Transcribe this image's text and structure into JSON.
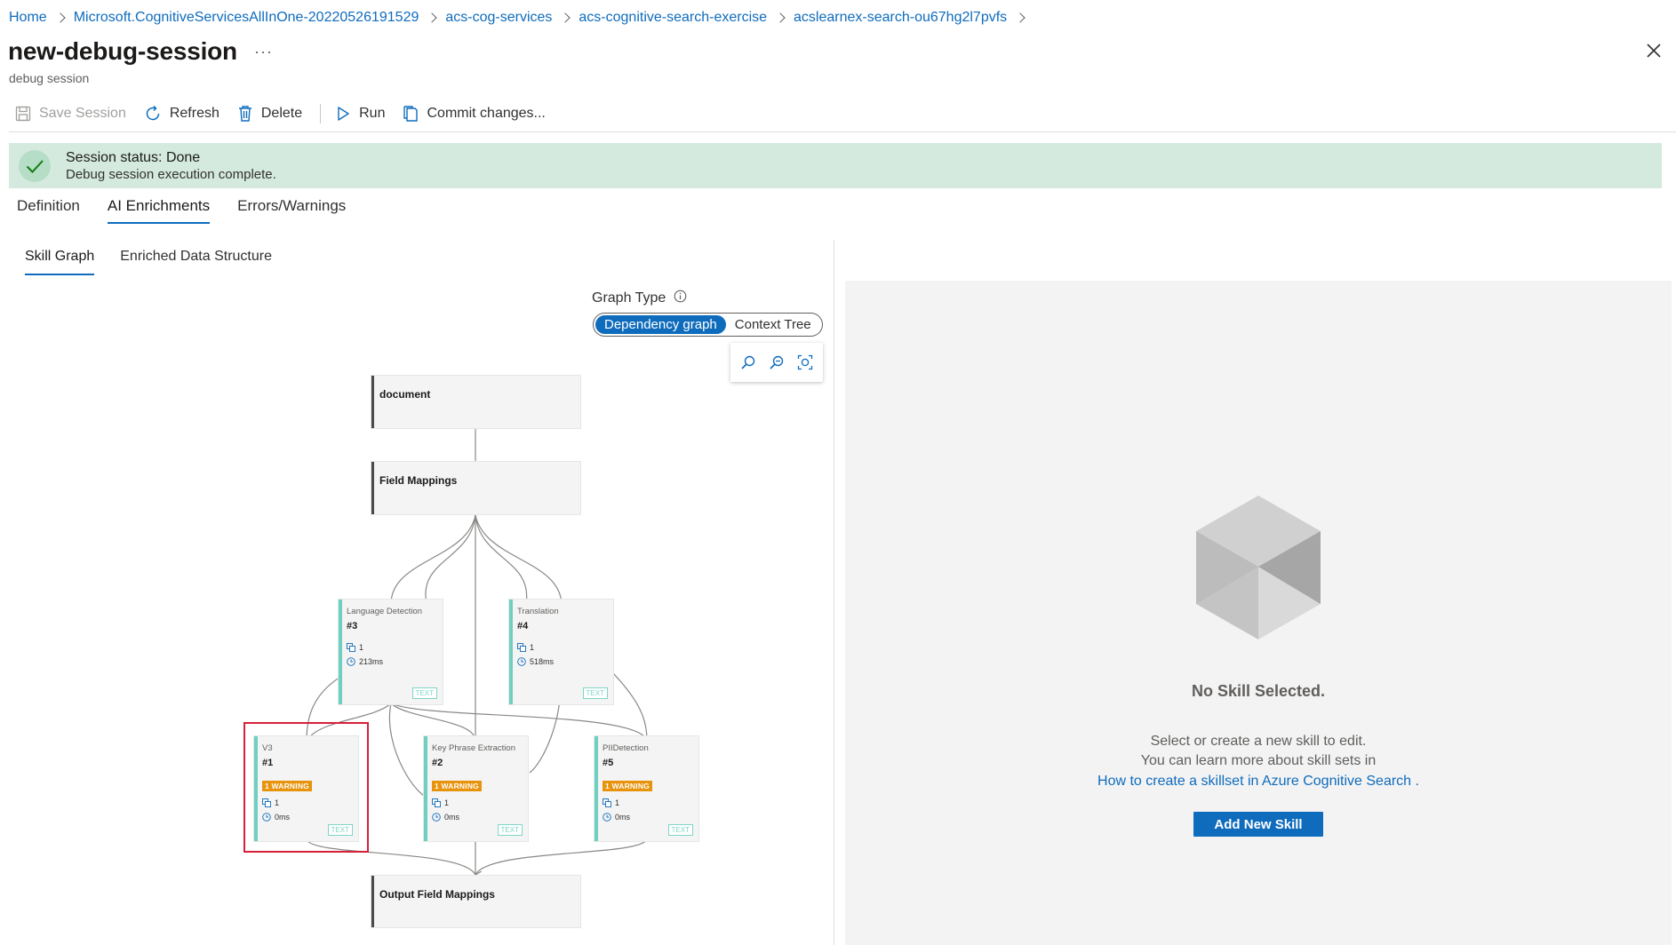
{
  "breadcrumb": [
    "Home",
    "Microsoft.CognitiveServicesAllInOne-20220526191529",
    "acs-cog-services",
    "acs-cognitive-search-exercise",
    "acslearnex-search-ou67hg2l7pvfs"
  ],
  "header": {
    "title": "new-debug-session",
    "more": "···",
    "subtitle": "debug session"
  },
  "toolbar": {
    "save_label": "Save Session",
    "refresh_label": "Refresh",
    "delete_label": "Delete",
    "run_label": "Run",
    "commit_label": "Commit changes..."
  },
  "status": {
    "title": "Session status: Done",
    "detail": "Debug session execution complete."
  },
  "tabs": [
    "Definition",
    "AI Enrichments",
    "Errors/Warnings"
  ],
  "active_tab": "AI Enrichments",
  "subtabs": [
    "Skill Graph",
    "Enriched Data Structure"
  ],
  "active_subtab": "Skill Graph",
  "graph_type": {
    "label": "Graph Type",
    "options": [
      "Dependency graph",
      "Context Tree"
    ],
    "selected": "Dependency graph"
  },
  "graph": {
    "document": "document",
    "field_mappings": "Field Mappings",
    "output_field_mappings": "Output Field Mappings",
    "skills": [
      {
        "kind": "Language Detection",
        "num": "#3",
        "count": "1",
        "time": "213ms",
        "warning": "",
        "tag": "TEXT"
      },
      {
        "kind": "Translation",
        "num": "#4",
        "count": "1",
        "time": "518ms",
        "warning": "",
        "tag": "TEXT"
      },
      {
        "kind": "V3",
        "num": "#1",
        "count": "1",
        "time": "0ms",
        "warning": "1 WARNING",
        "tag": "TEXT"
      },
      {
        "kind": "Key Phrase Extraction",
        "num": "#2",
        "count": "1",
        "time": "0ms",
        "warning": "1 WARNING",
        "tag": "TEXT"
      },
      {
        "kind": "PIIDetection",
        "num": "#5",
        "count": "1",
        "time": "0ms",
        "warning": "1 WARNING",
        "tag": "TEXT"
      }
    ]
  },
  "right_panel": {
    "empty_title": "No Skill Selected.",
    "line1": "Select or create a new skill to edit.",
    "line2": "You can learn more about skill sets in",
    "link": "How to create a skillset in Azure Cognitive Search",
    "link_suffix": " .",
    "add_button": "Add New Skill"
  },
  "colors": {
    "accent": "#0f6cbd",
    "status_bg": "#d5eadf",
    "warning": "#e8930c",
    "skill_bar": "#6fcfc1",
    "highlight": "#d71f3a"
  }
}
